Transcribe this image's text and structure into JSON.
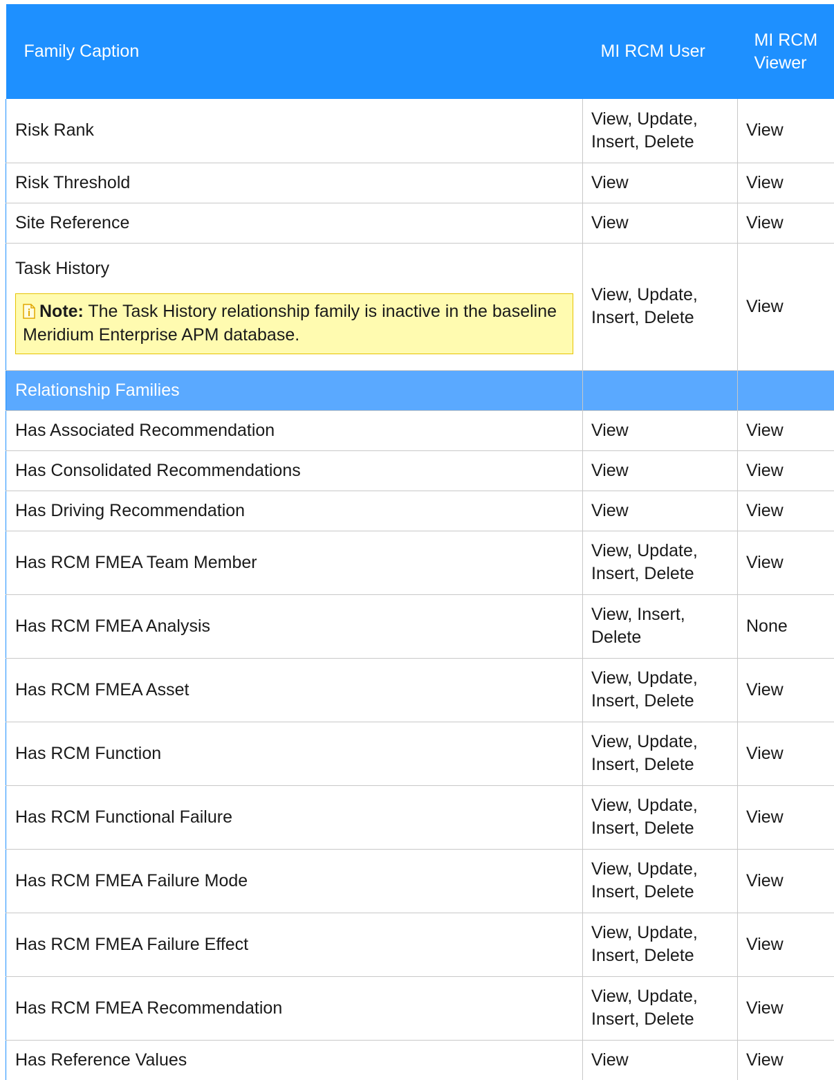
{
  "header": {
    "family_caption": "Family Caption",
    "user": "MI RCM User",
    "viewer": "MI RCM Viewer"
  },
  "rows_top": [
    {
      "family": "Risk Rank",
      "user": "View, Update, Insert, Delete",
      "viewer": "View"
    },
    {
      "family": "Risk Threshold",
      "user": "View",
      "viewer": "View"
    },
    {
      "family": "Site Reference",
      "user": "View",
      "viewer": "View"
    }
  ],
  "task_history": {
    "family": "Task History",
    "note_label": "Note:",
    "note_text": " The Task History relationship family is inactive in the baseline Meridium Enterprise APM database.",
    "user": "View, Update, Insert, Delete",
    "viewer": "View"
  },
  "section": {
    "label": "Relationship Families"
  },
  "rows_rel": [
    {
      "family": "Has Associated Recommendation",
      "user": "View",
      "viewer": "View"
    },
    {
      "family": "Has Consolidated Recommendations",
      "user": "View",
      "viewer": "View"
    },
    {
      "family": "Has Driving Recommendation",
      "user": "View",
      "viewer": "View"
    },
    {
      "family": "Has RCM FMEA Team Member",
      "user": "View, Update, Insert, Delete",
      "viewer": "View"
    },
    {
      "family": "Has RCM FMEA Analysis",
      "user": "View, Insert, Delete",
      "viewer": "None"
    },
    {
      "family": "Has RCM FMEA Asset",
      "user": "View, Update, Insert, Delete",
      "viewer": "View"
    },
    {
      "family": "Has RCM Function",
      "user": "View, Update, Insert, Delete",
      "viewer": "View"
    },
    {
      "family": "Has RCM Functional Failure",
      "user": "View, Update, Insert, Delete",
      "viewer": "View"
    },
    {
      "family": "Has RCM FMEA Failure Mode",
      "user": "View, Update, Insert, Delete",
      "viewer": "View"
    },
    {
      "family": "Has RCM FMEA Failure Effect",
      "user": "View, Update, Insert, Delete",
      "viewer": "View"
    },
    {
      "family": "Has RCM FMEA Recommendation",
      "user": "View, Update, Insert, Delete",
      "viewer": "View"
    },
    {
      "family": "Has Reference Values",
      "user": "View",
      "viewer": "View"
    }
  ],
  "colors": {
    "header_bg": "#1e90ff",
    "section_bg": "#5aa9ff",
    "note_bg": "#fffbb0",
    "note_border": "#e6c300"
  },
  "icons": {
    "note": "note-document-icon"
  }
}
